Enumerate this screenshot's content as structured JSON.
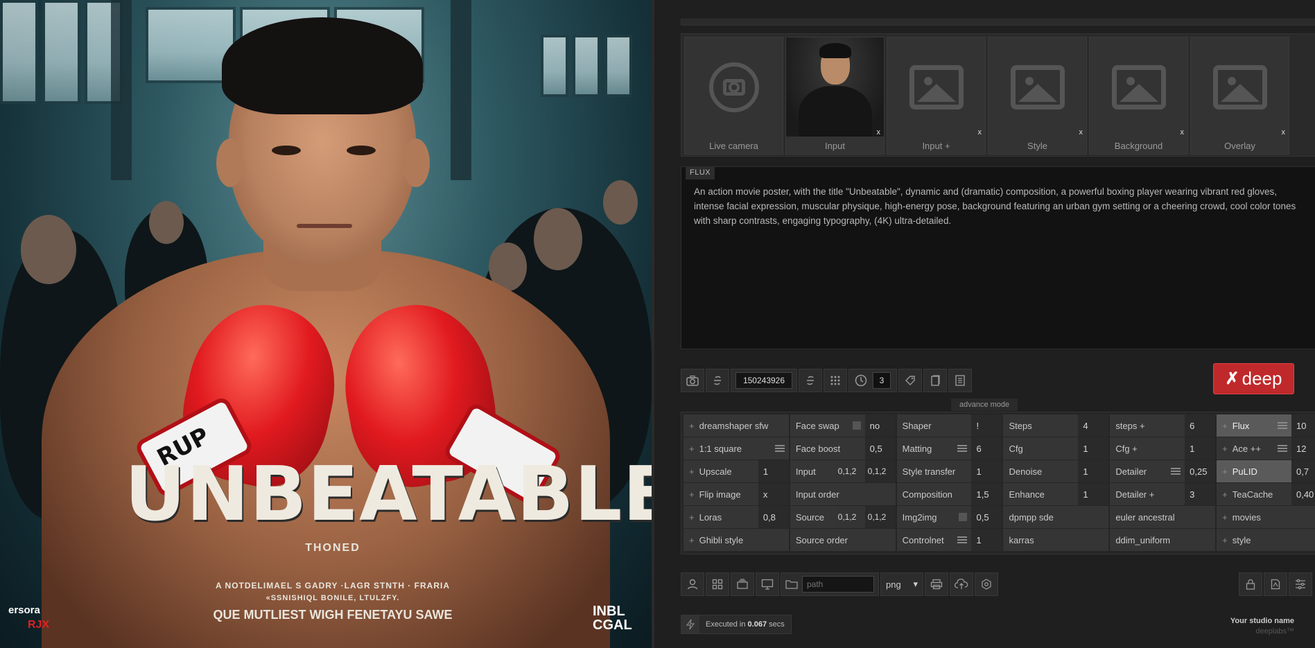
{
  "preview": {
    "poster_title": "UNBEATABLE",
    "poster_subtitle": "THONED",
    "poster_line1": "A NOTDELIMAEL S GADRY ·LAGR STNTH · FRARIA",
    "poster_line2": "«SSNISHIQL BONILE, LTULZFY.",
    "poster_tagline": "QUE MUTLIEST WIGH FENETAYU SAWE",
    "corner_left_top": "ersora",
    "corner_left_bottom": "RJX",
    "corner_right": "INBL CGAL",
    "glove_text": "RUP"
  },
  "slots": [
    {
      "label": "Live camera",
      "icon": "camera-icon",
      "closable": false
    },
    {
      "label": "Input",
      "icon": "person-photo",
      "closable": true
    },
    {
      "label": "Input +",
      "icon": "image-placeholder-icon",
      "closable": true
    },
    {
      "label": "Style",
      "icon": "image-placeholder-icon",
      "closable": true
    },
    {
      "label": "Background",
      "icon": "image-placeholder-icon",
      "closable": true
    },
    {
      "label": "Overlay",
      "icon": "image-placeholder-icon",
      "closable": true
    }
  ],
  "close_glyph": "x",
  "prompt": {
    "tag": "FLUX",
    "text": "An action movie poster, with the title \"Unbeatable\", dynamic and (dramatic) composition, a powerful boxing player wearing vibrant red gloves, intense facial expression, muscular physique, high-energy pose, background featuring an urban gym setting or a cheering crowd, cool color tones with sharp contrasts, engaging typography, (4K) ultra-detailed."
  },
  "toolbar": {
    "seed": "150243926",
    "steps_count": "3"
  },
  "deep_button": {
    "logo": "✗",
    "label": "deep"
  },
  "advance_mode_label": "advance mode",
  "grid": {
    "col1": [
      {
        "name": "dreamshaper sfw",
        "val": ""
      },
      {
        "name": "1:1 square",
        "val": ""
      },
      {
        "name": "Upscale",
        "val": "1"
      },
      {
        "name": "Flip image",
        "val": "x"
      },
      {
        "name": "Loras",
        "val": "0,8"
      },
      {
        "name": "Ghibli style",
        "val": ""
      }
    ],
    "col2": [
      {
        "name": "Face swap",
        "val": "no"
      },
      {
        "name": "Face boost",
        "val": "0,5"
      },
      {
        "name": "Input",
        "mid": "0,1,2",
        "val": "0,1,2"
      },
      {
        "name": "Input order",
        "val": ""
      },
      {
        "name": "Source",
        "mid": "0,1,2",
        "val": "0,1,2"
      },
      {
        "name": "Source order",
        "val": ""
      }
    ],
    "col3": [
      {
        "name": "Shaper",
        "val": "!"
      },
      {
        "name": "Matting",
        "val": "6"
      },
      {
        "name": "Style transfer",
        "val": "1"
      },
      {
        "name": "Composition",
        "val": "1,5"
      },
      {
        "name": "Img2img",
        "val": "0,5"
      },
      {
        "name": "Controlnet",
        "val": "1"
      }
    ],
    "col4": [
      {
        "name": "Steps",
        "val": "4"
      },
      {
        "name": "Cfg",
        "val": "1"
      },
      {
        "name": "Denoise",
        "val": "1"
      },
      {
        "name": "Enhance",
        "val": "1"
      },
      {
        "name": "dpmpp sde",
        "val": ""
      },
      {
        "name": "karras",
        "val": ""
      }
    ],
    "col5": [
      {
        "name": "steps +",
        "val": "6"
      },
      {
        "name": "Cfg +",
        "val": "1"
      },
      {
        "name": "Detailer",
        "val": "0,25"
      },
      {
        "name": "Detailer +",
        "val": "3"
      },
      {
        "name": "euler ancestral",
        "val": ""
      },
      {
        "name": "ddim_uniform",
        "val": ""
      }
    ],
    "col6": [
      {
        "name": "Flux",
        "val": "10"
      },
      {
        "name": "Ace ++",
        "val": "12"
      },
      {
        "name": "PuLID",
        "val": "0,7"
      },
      {
        "name": "TeaCache",
        "val": "0,40"
      },
      {
        "name": "movies",
        "val": ""
      },
      {
        "name": "style",
        "val": ""
      }
    ]
  },
  "bottombar": {
    "path_placeholder": "path",
    "format": "png"
  },
  "status": {
    "prefix": "Executed in",
    "value": "0.067",
    "suffix": "secs"
  },
  "studio": {
    "name": "Your studio name",
    "brand": "deeplabs™"
  }
}
